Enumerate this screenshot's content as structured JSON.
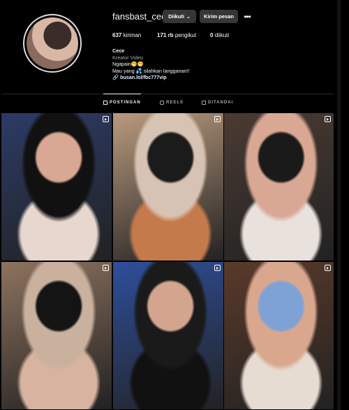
{
  "profile": {
    "username": "fansbast_cece",
    "follow_label": "Diikuti",
    "message_label": "Kirim pesan",
    "more_label": "•••",
    "stats": {
      "posts": "637",
      "posts_label": "kiriman",
      "followers": "171 rb",
      "followers_label": "pengikut",
      "following": "0",
      "following_label": "diikuti"
    },
    "bio": {
      "name": "Cece",
      "category": "Kreator Video",
      "line1": "Ngapain🤭🤭",
      "line2": "Mau yang 💦 silahkan langganan!!",
      "link": "🔗 busan.lol/fbc777vip"
    }
  },
  "tabs": [
    {
      "label": "POSTINGAN",
      "icon": "grid-icon"
    },
    {
      "label": "REELS",
      "icon": "reels-icon"
    },
    {
      "label": "DITANDAI",
      "icon": "tagged-icon"
    }
  ],
  "grid": {
    "posts": [
      {
        "type": "reel",
        "colors": [
          "#2c3b66",
          "#111",
          "#d8a894",
          "#e7d7cf"
        ]
      },
      {
        "type": "reel",
        "colors": [
          "#b99a7e",
          "#d7c3b3",
          "#1b1b1b",
          "#c57a4b"
        ]
      },
      {
        "type": "reel",
        "colors": [
          "#4a3b33",
          "#d9a894",
          "#1a1a1a",
          "#e9e1dc"
        ]
      },
      {
        "type": "reel",
        "colors": [
          "#8e735f",
          "#c9b19e",
          "#141414",
          "#d7b3a0"
        ]
      },
      {
        "type": "reel",
        "colors": [
          "#2e4f9c",
          "#1a1a1a",
          "#d3a58f",
          "#111"
        ]
      },
      {
        "type": "reel",
        "colors": [
          "#5a3a2a",
          "#d9a78e",
          "#7fa2d6",
          "#e6dcd2"
        ]
      }
    ]
  }
}
